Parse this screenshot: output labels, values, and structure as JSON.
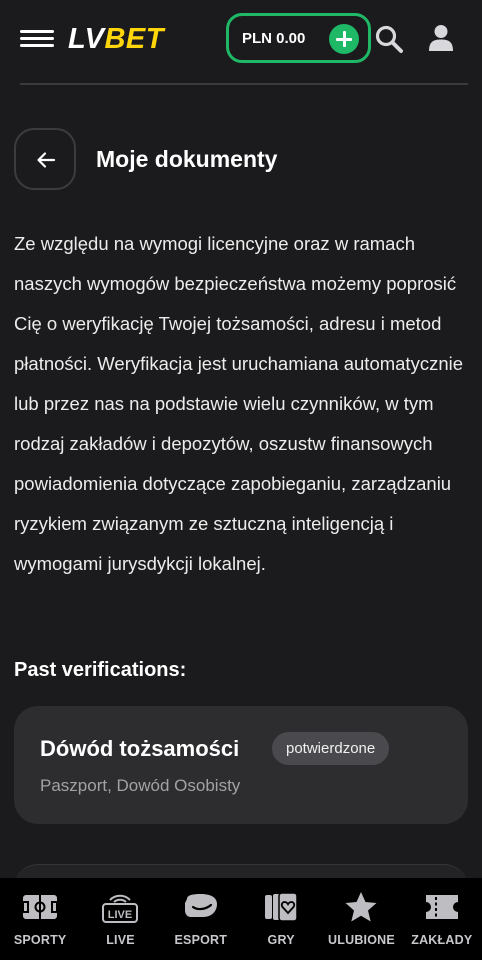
{
  "header": {
    "logo_lv": "LV",
    "logo_bet": "BET",
    "balance_label": "PLN 0.00"
  },
  "page": {
    "title": "Moje dokumenty",
    "intro": "Ze względu na wymogi licencyjne oraz w ramach naszych wymogów bezpieczeństwa możemy poprosić Cię o weryfikację Twojej tożsamości, adresu i metod płatności. Weryfikacja jest uruchamiana automatycznie lub przez nas na podstawie wielu czynników, w tym rodzaj zakładów i depozytów, oszustw finansowych powiadomienia dotyczące zapobieganiu, zarządzaniu ryzykiem związanym ze sztuczną inteligencją i wymogami jurysdykcji lokalnej.",
    "section_title": "Past verifications:"
  },
  "verifications": [
    {
      "title": "Dówód tożsamości",
      "status": "potwierdzone",
      "documents": "Paszport, Dowód Osobisty"
    }
  ],
  "bottom_nav": {
    "items": [
      {
        "label": "SPORTY",
        "icon": "field-icon"
      },
      {
        "label": "LIVE",
        "icon": "live-icon"
      },
      {
        "label": "ESPORT",
        "icon": "gamepad-icon"
      },
      {
        "label": "GRY",
        "icon": "cards-icon"
      },
      {
        "label": "ULUBIONE",
        "icon": "star-icon"
      },
      {
        "label": "ZAKŁADY",
        "icon": "ticket-icon"
      }
    ]
  },
  "colors": {
    "background": "#1b1b1d",
    "accent_green": "#1eb866",
    "logo_yellow": "#ffd60a",
    "card": "#2d2d30",
    "nav_background": "#000000"
  }
}
